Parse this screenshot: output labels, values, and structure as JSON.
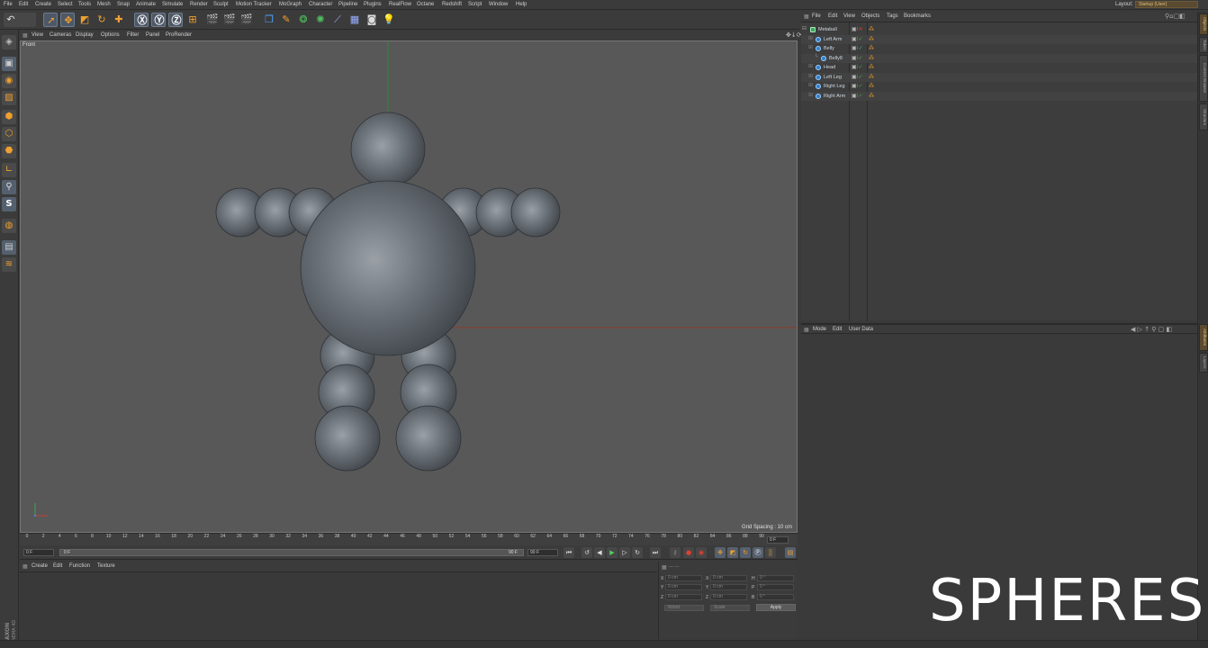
{
  "menu": [
    "File",
    "Edit",
    "Create",
    "Select",
    "Tools",
    "Mesh",
    "Snap",
    "Animate",
    "Simulate",
    "Render",
    "Sculpt",
    "Motion Tracker",
    "MoGraph",
    "Character",
    "Pipeline",
    "Plugins",
    "RealFlow",
    "Octane",
    "Redshift",
    "Script",
    "Window",
    "Help"
  ],
  "layout": {
    "label": "Layout:",
    "value": "Startup (User)"
  },
  "viewport": {
    "menu": [
      "View",
      "Cameras",
      "Display",
      "Options",
      "Filter",
      "Panel",
      "ProRender"
    ],
    "name": "Front",
    "grid_spacing": "Grid Spacing : 10 cm"
  },
  "timeline": {
    "ticks": [
      "0",
      "2",
      "4",
      "6",
      "8",
      "10",
      "12",
      "14",
      "16",
      "18",
      "20",
      "22",
      "24",
      "26",
      "28",
      "30",
      "32",
      "34",
      "36",
      "38",
      "40",
      "42",
      "44",
      "46",
      "48",
      "50",
      "52",
      "54",
      "56",
      "58",
      "60",
      "62",
      "64",
      "66",
      "68",
      "70",
      "72",
      "74",
      "76",
      "78",
      "80",
      "82",
      "84",
      "86",
      "88",
      "90"
    ],
    "current_frame": "0 F",
    "start_frame": "0 F",
    "range_start": "0 F",
    "range_end": "90 F",
    "end_frame": "90 F"
  },
  "material_manager": {
    "menu": [
      "Create",
      "Edit",
      "Function",
      "Texture"
    ]
  },
  "coordinates": {
    "rows": [
      {
        "a": "X",
        "av": "0 cm",
        "b": "X",
        "bv": "0 cm",
        "c": "H",
        "cv": "0 °"
      },
      {
        "a": "Y",
        "av": "0 cm",
        "b": "Y",
        "bv": "0 cm",
        "c": "P",
        "cv": "0 °"
      },
      {
        "a": "Z",
        "av": "0 cm",
        "b": "Z",
        "bv": "0 cm",
        "c": "B",
        "cv": "0 °"
      }
    ],
    "mode": "World",
    "size_mode": "Scale",
    "apply": "Apply"
  },
  "object_manager": {
    "menu": [
      "File",
      "Edit",
      "View",
      "Objects",
      "Tags",
      "Bookmarks"
    ],
    "objects": [
      {
        "name": "Metaball",
        "icon": "metaball-icon",
        "depth": 0
      },
      {
        "name": "Left Arm",
        "icon": "sphere-icon",
        "depth": 1
      },
      {
        "name": "Belly",
        "icon": "sphere-icon",
        "depth": 1
      },
      {
        "name": "Belly8",
        "icon": "sphere-icon",
        "depth": 2
      },
      {
        "name": "Head",
        "icon": "sphere-icon",
        "depth": 1
      },
      {
        "name": "Left Leg",
        "icon": "sphere-icon",
        "depth": 1
      },
      {
        "name": "Right Leg",
        "icon": "sphere-icon",
        "depth": 1
      },
      {
        "name": "Right Arm",
        "icon": "sphere-icon",
        "depth": 1
      }
    ]
  },
  "attribute_manager": {
    "menu": [
      "Mode",
      "Edit",
      "User Data"
    ]
  },
  "side_tabs": [
    "Objects",
    "Takes",
    "Content Browser",
    "Structure"
  ],
  "side_tabs_lower": [
    "Attributes",
    "Layers"
  ],
  "branding": "MAXON CINEMA 4D",
  "watermark": "SPHERES",
  "colors": {
    "accent": "#e59a2a",
    "viewport_bg": "#585858",
    "panel_bg": "#3a3a3a",
    "sphere": "#5c626a"
  }
}
